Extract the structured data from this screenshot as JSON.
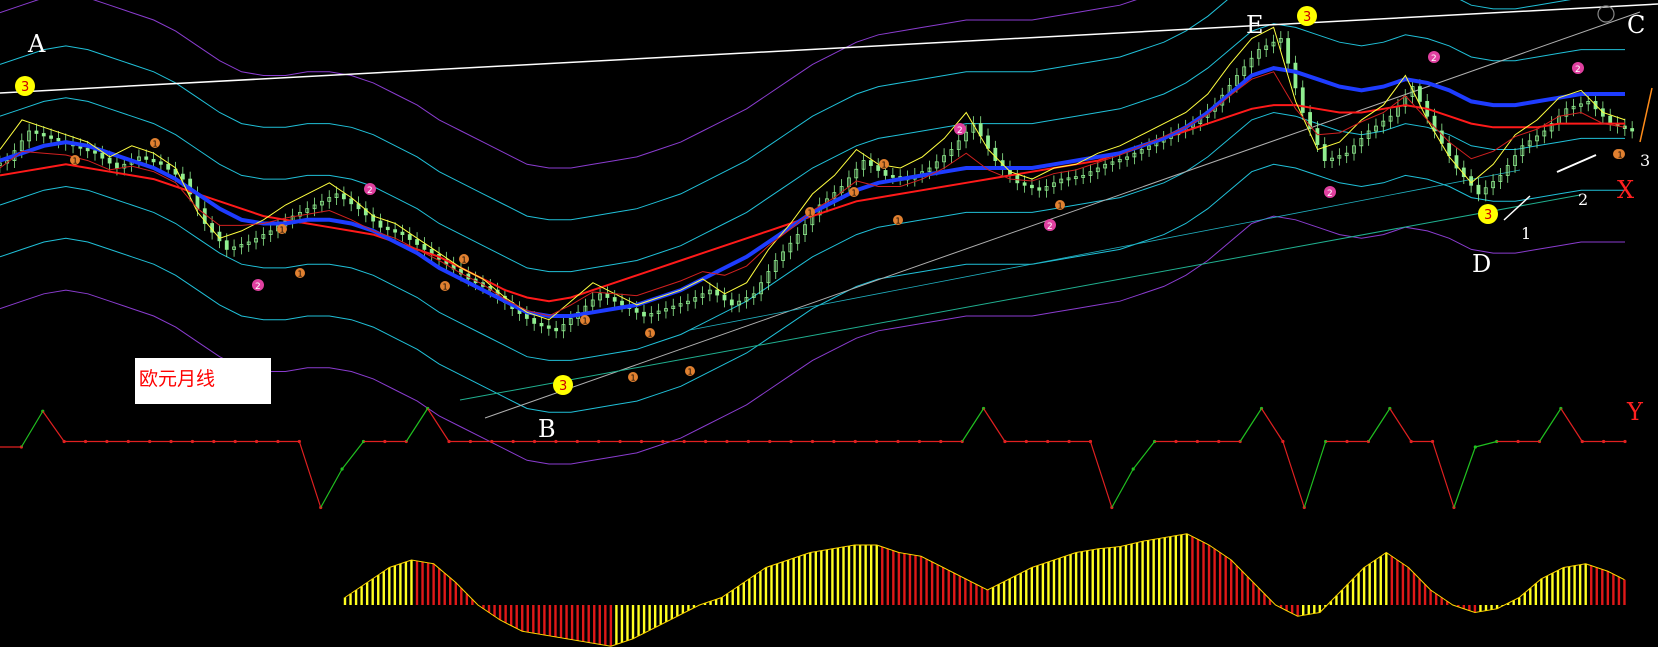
{
  "title": "欧元月线",
  "colors": {
    "background": "#000000",
    "candle": "#90ee90",
    "ma_blue": "#1e3cff",
    "ma_red": "#ff1a1a",
    "ma_yellow": "#ffff40",
    "band_cyan": "#20c0d8",
    "band_purple": "#8a3ccf",
    "trend_white": "#ffffff",
    "osc_up": "#20c020",
    "osc_down": "#e02020",
    "hist_up": "#ffff20",
    "hist_down": "#e01818"
  },
  "wave_labels": {
    "A": "A",
    "B": "B",
    "C": "C",
    "D": "D",
    "E": "E",
    "X": "X",
    "Y": "Y",
    "n1": "1",
    "n2": "2",
    "n3": "3"
  },
  "markers": {
    "big3": "3",
    "small1": "1",
    "small2": "2"
  },
  "chart_data": {
    "type": "line",
    "price_panel": {
      "close": [
        0.62,
        0.7,
        0.68,
        0.66,
        0.64,
        0.6,
        0.63,
        0.61,
        0.57,
        0.45,
        0.38,
        0.4,
        0.43,
        0.47,
        0.5,
        0.53,
        0.49,
        0.44,
        0.42,
        0.38,
        0.34,
        0.3,
        0.27,
        0.22,
        0.18,
        0.16,
        0.21,
        0.26,
        0.23,
        0.2,
        0.22,
        0.24,
        0.27,
        0.23,
        0.26,
        0.35,
        0.42,
        0.5,
        0.55,
        0.62,
        0.58,
        0.57,
        0.6,
        0.65,
        0.72,
        0.62,
        0.56,
        0.54,
        0.57,
        0.58,
        0.61,
        0.63,
        0.66,
        0.69,
        0.72,
        0.77,
        0.85,
        0.92,
        0.95,
        0.75,
        0.62,
        0.64,
        0.7,
        0.74,
        0.82,
        0.7,
        0.6,
        0.53,
        0.58,
        0.66,
        0.7,
        0.76,
        0.78,
        0.72,
        0.7
      ],
      "ma_red": [
        0.58,
        0.59,
        0.6,
        0.61,
        0.6,
        0.59,
        0.58,
        0.57,
        0.55,
        0.53,
        0.51,
        0.49,
        0.47,
        0.46,
        0.45,
        0.44,
        0.43,
        0.42,
        0.4,
        0.38,
        0.36,
        0.33,
        0.3,
        0.27,
        0.25,
        0.24,
        0.25,
        0.27,
        0.29,
        0.31,
        0.33,
        0.35,
        0.37,
        0.39,
        0.41,
        0.43,
        0.45,
        0.47,
        0.49,
        0.51,
        0.52,
        0.53,
        0.54,
        0.55,
        0.56,
        0.57,
        0.58,
        0.59,
        0.6,
        0.61,
        0.62,
        0.64,
        0.66,
        0.68,
        0.7,
        0.72,
        0.74,
        0.76,
        0.77,
        0.77,
        0.76,
        0.75,
        0.75,
        0.76,
        0.77,
        0.76,
        0.74,
        0.72,
        0.71,
        0.71,
        0.71,
        0.72,
        0.72,
        0.72,
        0.72
      ],
      "ma_blue": [
        0.62,
        0.64,
        0.66,
        0.67,
        0.66,
        0.64,
        0.62,
        0.6,
        0.57,
        0.53,
        0.49,
        0.46,
        0.45,
        0.45,
        0.46,
        0.46,
        0.45,
        0.43,
        0.4,
        0.37,
        0.33,
        0.3,
        0.27,
        0.24,
        0.21,
        0.2,
        0.2,
        0.21,
        0.22,
        0.23,
        0.25,
        0.27,
        0.3,
        0.33,
        0.36,
        0.4,
        0.44,
        0.48,
        0.51,
        0.54,
        0.56,
        0.57,
        0.58,
        0.59,
        0.6,
        0.6,
        0.6,
        0.6,
        0.61,
        0.62,
        0.63,
        0.64,
        0.66,
        0.68,
        0.71,
        0.75,
        0.8,
        0.85,
        0.87,
        0.86,
        0.84,
        0.82,
        0.81,
        0.82,
        0.84,
        0.83,
        0.81,
        0.78,
        0.77,
        0.77,
        0.78,
        0.79,
        0.8,
        0.8,
        0.8
      ]
    },
    "oscillator": {
      "values": [
        0.2,
        0.2,
        0.85,
        0.3,
        0.3,
        0.3,
        0.3,
        0.3,
        0.3,
        0.3,
        0.3,
        0.3,
        0.3,
        0.3,
        0.3,
        -0.9,
        -0.2,
        0.3,
        0.3,
        0.3,
        0.9,
        0.3,
        0.3,
        0.3,
        0.3,
        0.3,
        0.3,
        0.3,
        0.3,
        0.3,
        0.3,
        0.3,
        0.3,
        0.3,
        0.3,
        0.3,
        0.3,
        0.3,
        0.3,
        0.3,
        0.3,
        0.3,
        0.3,
        0.3,
        0.3,
        0.3,
        0.9,
        0.3,
        0.3,
        0.3,
        0.3,
        0.3,
        -0.9,
        -0.2,
        0.3,
        0.3,
        0.3,
        0.3,
        0.3,
        0.9,
        0.3,
        -0.9,
        0.3,
        0.3,
        0.3,
        0.9,
        0.3,
        0.3,
        -0.9,
        0.2,
        0.3,
        0.3,
        0.3,
        0.9,
        0.3,
        0.3,
        0.3
      ]
    },
    "histogram": {
      "values": [
        0.1,
        0.3,
        0.5,
        0.6,
        0.55,
        0.3,
        0.0,
        -0.2,
        -0.35,
        -0.4,
        -0.45,
        -0.5,
        -0.55,
        -0.45,
        -0.3,
        -0.15,
        0.0,
        0.1,
        0.3,
        0.5,
        0.6,
        0.7,
        0.75,
        0.8,
        0.8,
        0.7,
        0.65,
        0.5,
        0.35,
        0.2,
        0.35,
        0.5,
        0.6,
        0.7,
        0.75,
        0.78,
        0.85,
        0.9,
        0.95,
        0.8,
        0.6,
        0.3,
        0.0,
        -0.15,
        -0.1,
        0.2,
        0.5,
        0.7,
        0.5,
        0.2,
        0.0,
        -0.1,
        -0.05,
        0.1,
        0.35,
        0.5,
        0.55,
        0.45,
        0.3
      ]
    },
    "ylim": [
      0,
      1
    ]
  }
}
